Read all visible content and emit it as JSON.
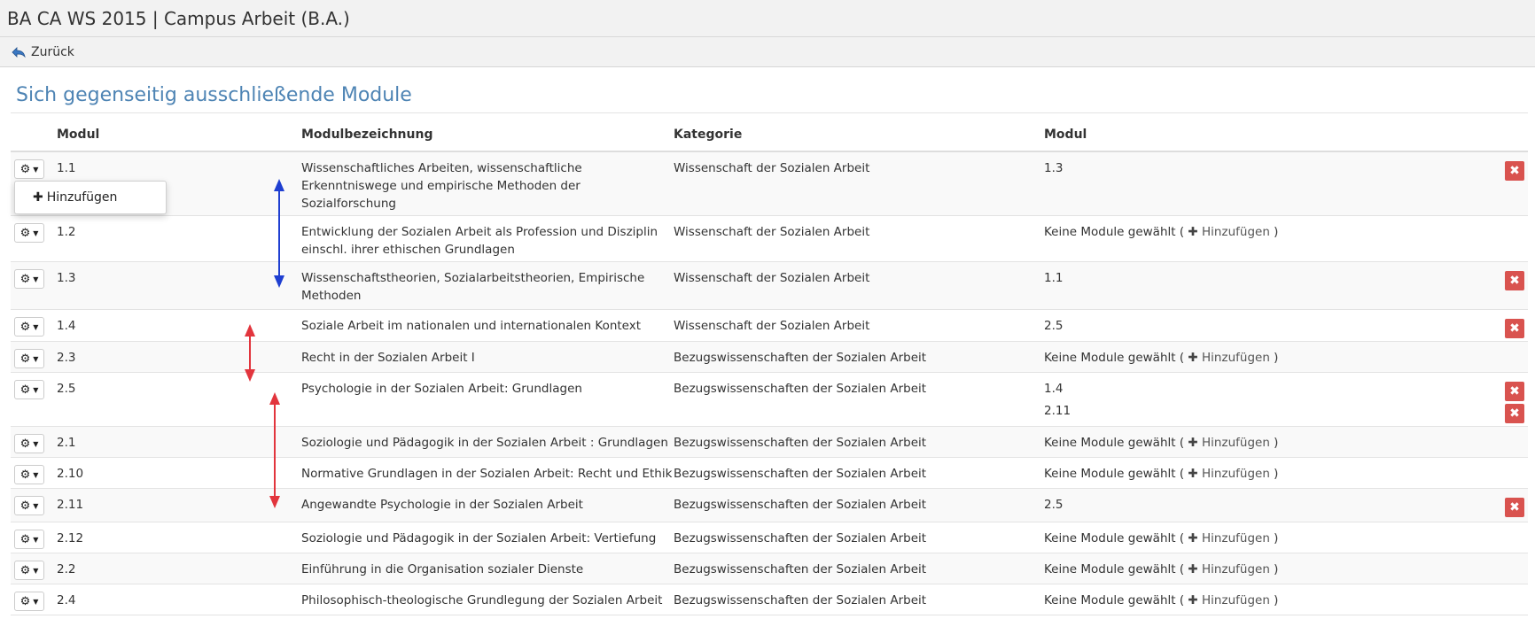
{
  "window": {
    "title": "BA CA WS 2015 | Campus Arbeit (B.A.)"
  },
  "toolbar": {
    "back_label": "Zurück",
    "back_icon": "back-arrow-icon"
  },
  "section": {
    "title": "Sich gegenseitig ausschließende Module"
  },
  "table": {
    "headers": {
      "modul": "Modul",
      "bezeichnung": "Modulbezeichnung",
      "kategorie": "Kategorie",
      "modul2": "Modul"
    },
    "empty_text": "Keine Module gewählt (",
    "add_label": "Hinzufügen",
    "add_close": ")",
    "rows": [
      {
        "id": "1.1",
        "name": "Wissenschaftliches Arbeiten, wissenschaftliche Erkenntniswege und empirische Methoden der Sozialforschung",
        "category": "Wissenschaft der Sozialen Arbeit",
        "modules": [
          "1.3"
        ]
      },
      {
        "id": "1.2",
        "name": "Entwicklung der Sozialen Arbeit als Profession und Disziplin einschl. ihrer ethischen Grundlagen",
        "category": "Wissenschaft der Sozialen Arbeit",
        "modules": []
      },
      {
        "id": "1.3",
        "name": "Wissenschaftstheorien, Sozialarbeitstheorien, Empirische Methoden",
        "category": "Wissenschaft der Sozialen Arbeit",
        "modules": [
          "1.1"
        ]
      },
      {
        "id": "1.4",
        "name": "Soziale Arbeit im nationalen und internationalen Kontext",
        "category": "Wissenschaft der Sozialen Arbeit",
        "modules": [
          "2.5"
        ]
      },
      {
        "id": "2.3",
        "name": "Recht in der Sozialen Arbeit I",
        "category": "Bezugswissenschaften der Sozialen Arbeit",
        "modules": []
      },
      {
        "id": "2.5",
        "name": "Psychologie in der Sozialen Arbeit: Grundlagen",
        "category": "Bezugswissenschaften der Sozialen Arbeit",
        "modules": [
          "1.4",
          "2.11"
        ]
      },
      {
        "id": "2.1",
        "name": "Soziologie und Pädagogik in der Sozialen Arbeit : Grundlagen",
        "category": "Bezugswissenschaften der Sozialen Arbeit",
        "modules": []
      },
      {
        "id": "2.10",
        "name": "Normative Grundlagen in der Sozialen Arbeit: Recht und Ethik",
        "category": "Bezugswissenschaften der Sozialen Arbeit",
        "modules": []
      },
      {
        "id": "2.11",
        "name": "Angewandte Psychologie in der Sozialen Arbeit",
        "category": "Bezugswissenschaften der Sozialen Arbeit",
        "modules": [
          "2.5"
        ]
      },
      {
        "id": "2.12",
        "name": "Soziologie und Pädagogik in der Sozialen Arbeit: Vertiefung",
        "category": "Bezugswissenschaften der Sozialen Arbeit",
        "modules": []
      },
      {
        "id": "2.2",
        "name": "Einführung in die Organisation sozialer Dienste",
        "category": "Bezugswissenschaften der Sozialen Arbeit",
        "modules": []
      },
      {
        "id": "2.4",
        "name": "Philosophisch-theologische Grundlegung der Sozialen Arbeit",
        "category": "Bezugswissenschaften der Sozialen Arbeit",
        "modules": []
      }
    ]
  },
  "dropdown": {
    "item_label": "Hinzufügen"
  },
  "colors": {
    "accent": "#4e84b4",
    "danger": "#d9534f",
    "arrow_blue": "#1f3fd1",
    "arrow_red": "#e2353d"
  }
}
